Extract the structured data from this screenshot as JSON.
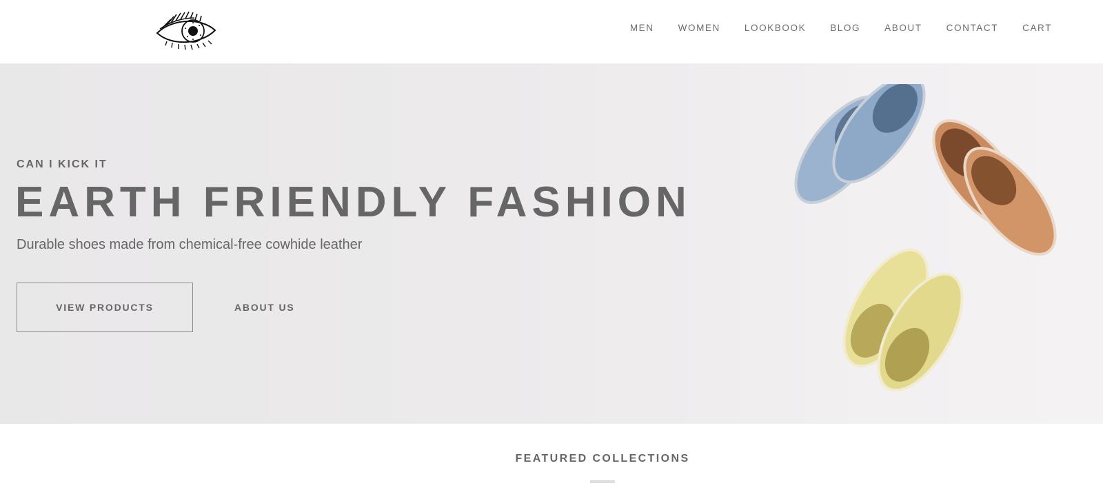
{
  "header": {
    "logo_name": "eye-logo",
    "nav": [
      "MEN",
      "WOMEN",
      "LOOKBOOK",
      "BLOG",
      "ABOUT",
      "CONTACT",
      "CART"
    ]
  },
  "hero": {
    "kicker": "CAN I KICK IT",
    "title": "EARTH FRIENDLY FASHION",
    "subtitle": "Durable shoes made from chemical-free cowhide leather",
    "primary_button": "VIEW PRODUCTS",
    "secondary_button": "ABOUT US",
    "image_name": "shoes-image",
    "shoe_colors": {
      "blue": "#8fa9c8",
      "tan": "#c98a5e",
      "yellow": "#e6dc92"
    }
  },
  "featured": {
    "title": "FEATURED COLLECTIONS"
  }
}
